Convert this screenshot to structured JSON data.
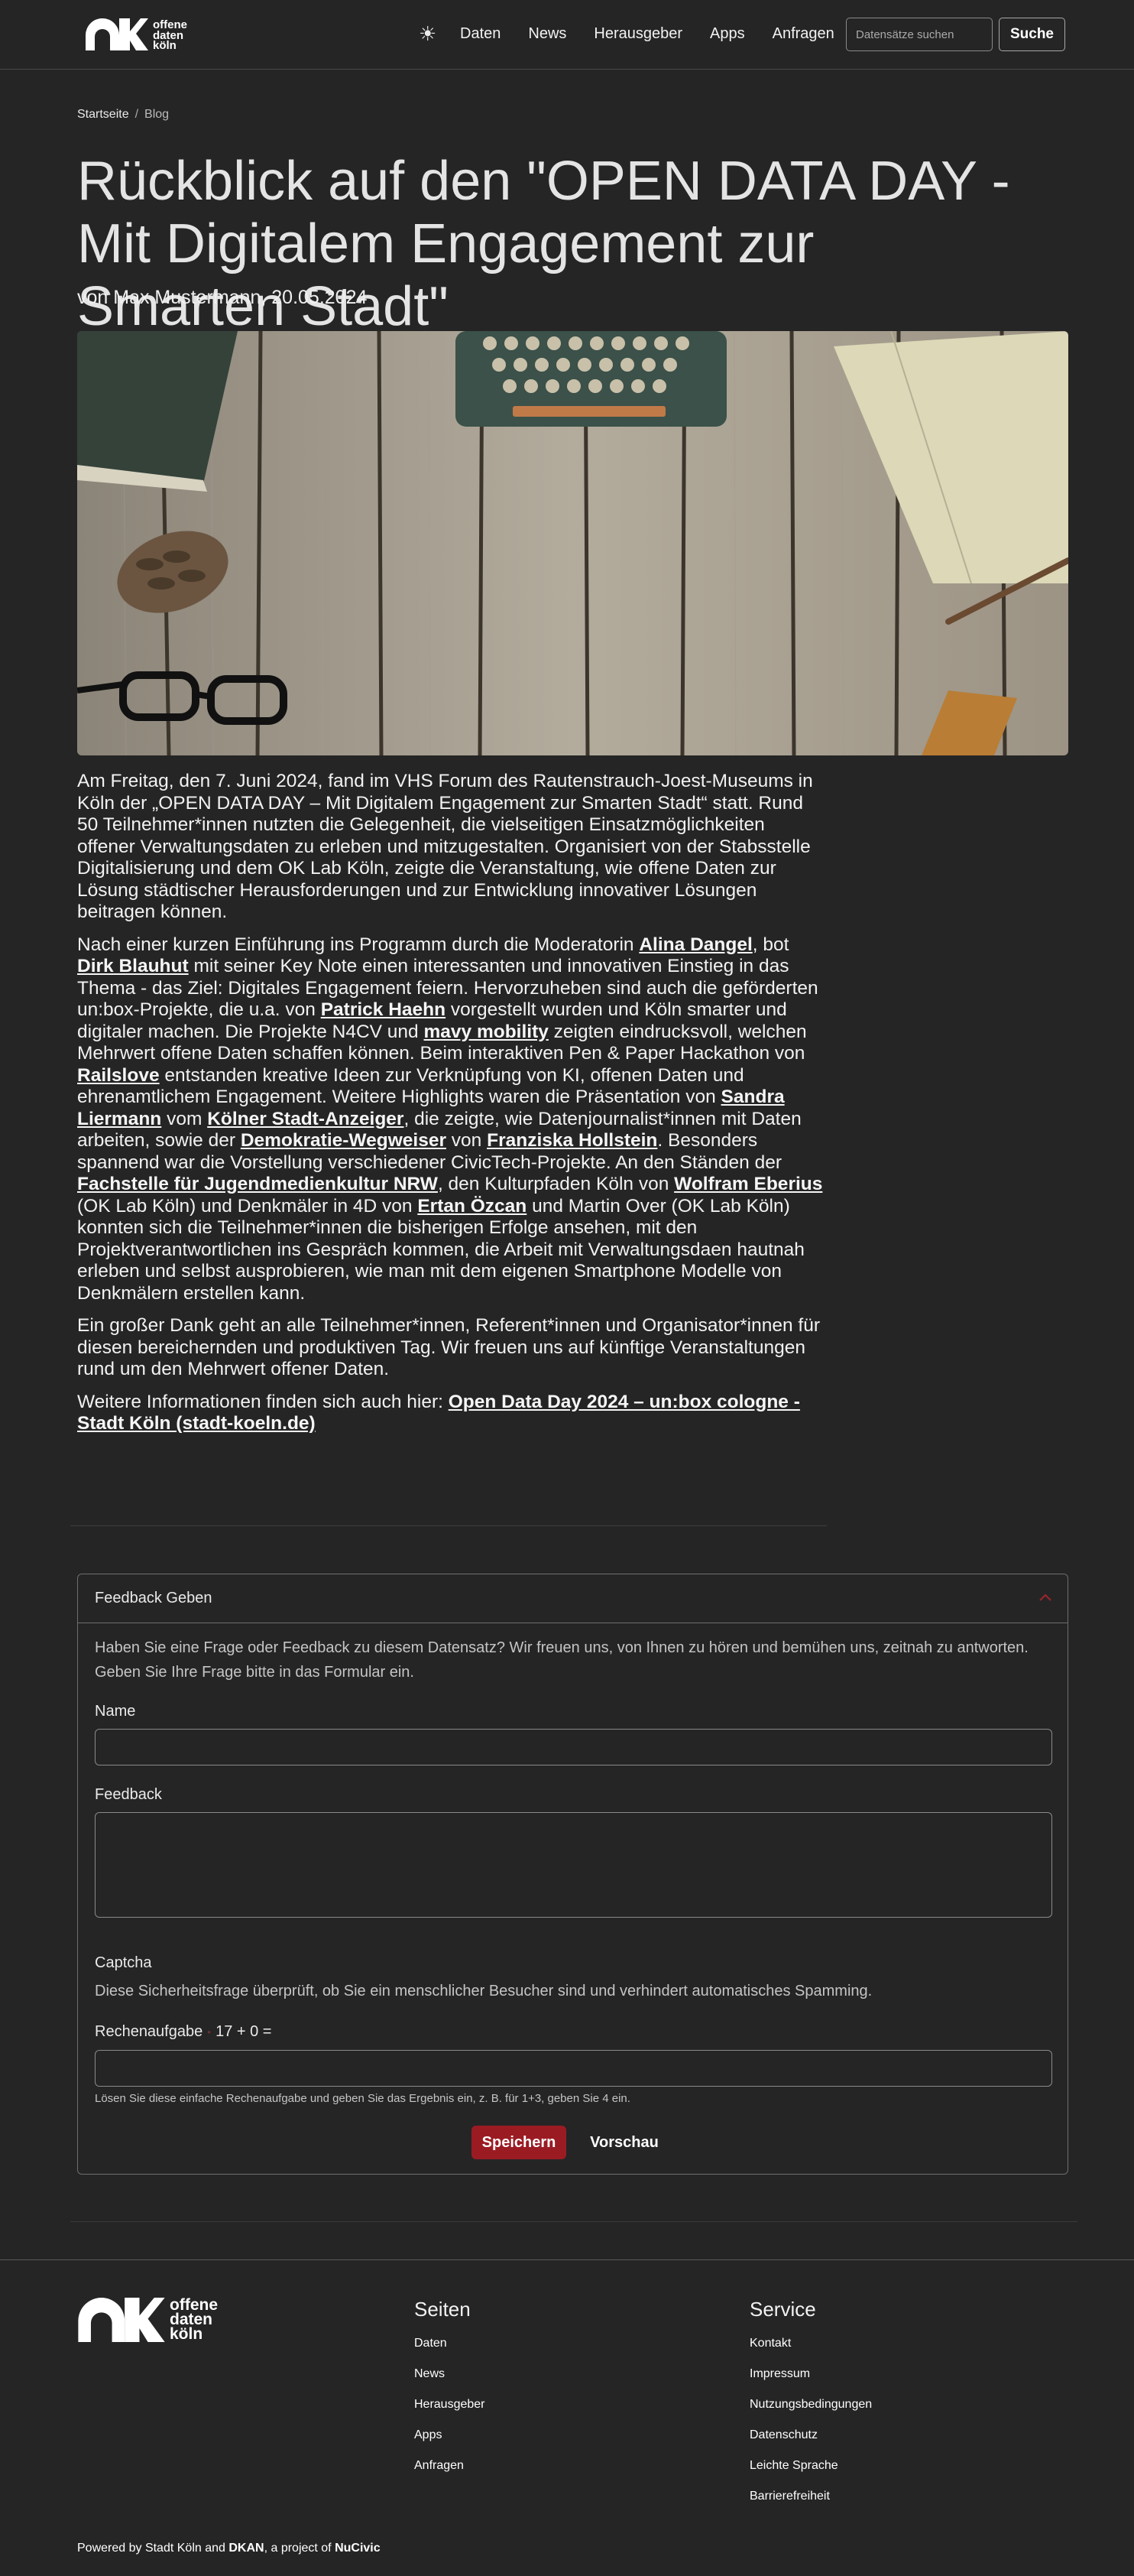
{
  "header": {
    "logo_lines": [
      "offene",
      "daten",
      "köln"
    ],
    "theme_icon": "☀",
    "nav": [
      "Daten",
      "News",
      "Herausgeber",
      "Apps",
      "Anfragen"
    ],
    "search_placeholder": "Datensätze suchen",
    "search_button": "Suche"
  },
  "breadcrumb": {
    "home": "Startseite",
    "separator": "/",
    "current": "Blog"
  },
  "article": {
    "title": "Rückblick auf den \"OPEN DATA DAY - Mit Digitalem Engagement zur Smarten Stadt\"",
    "byline": "von Max Mustermann, 20.05.2024",
    "p1": "Am Freitag, den 7. Juni 2024, fand im VHS Forum des Rautenstrauch-Joest-Museums in Köln der „OPEN DATA DAY – Mit Digitalem Engagement zur Smarten Stadt“ statt. Rund 50 Teilnehmer*innen nutzten die Gelegenheit, die vielseitigen Einsatzmöglichkeiten offener Verwaltungsdaten zu erleben und mitzugestalten. Organisiert von der Stabsstelle Digitalisierung und dem OK Lab Köln, zeigte die Veranstaltung, wie offene Daten zur Lösung städtischer Herausforderungen und zur Entwicklung innovativer Lösungen beitragen können.",
    "p2": {
      "t1": "Nach einer kurzen Einführung ins Programm durch die Moderatorin ",
      "l1": "Alina Dangel",
      "t2": ", bot ",
      "l2": "Dirk Blauhut",
      "t3": " mit seiner Key Note einen interessanten und innovativen Einstieg in das Thema - das Ziel: Digitales Engagement feiern. Hervorzuheben sind auch die geförderten un:box-Projekte, die u.a. von ",
      "l3": "Patrick Haehn",
      "t4": " vorgestellt wurden und Köln smarter und digitaler machen. Die Projekte N4CV und ",
      "l4": "mavy mobility",
      "t5": " zeigten eindrucksvoll, welchen Mehrwert offene Daten schaffen können. Beim interaktiven Pen & Paper Hackathon von ",
      "l5": "Railslove",
      "t6": " entstanden kreative Ideen zur Verknüpfung von KI, offenen Daten und ehrenamtlichem Engagement. Weitere Highlights waren die Präsentation von ",
      "l6": "Sandra Liermann",
      "t7": " vom ",
      "l7": "Kölner Stadt-Anzeiger",
      "t8": ", die zeigte, wie Datenjournalist*innen mit Daten arbeiten, sowie der ",
      "l8": "Demokratie-Wegweiser",
      "t9": " von ",
      "l9": "Franziska Hollstein",
      "t10": ". Besonders spannend war die Vorstellung verschiedener CivicTech-Projekte. An den Ständen der ",
      "l10": "Fachstelle für Jugendmedienkultur NRW",
      "t11": ", den Kulturpfaden Köln von ",
      "l11": "Wolfram Eberius",
      "t12": " (OK Lab Köln) und Denkmäler in 4D von ",
      "l12": "Ertan Özcan",
      "t13": " und Martin Over (OK Lab Köln) konnten sich die Teilnehmer*innen die bisherigen Erfolge ansehen, mit den Projektverantwortlichen ins Gespräch kommen, die Arbeit mit Verwaltungsdaen hautnah erleben und selbst ausprobieren, wie man mit dem eigenen Smartphone Modelle von Denkmälern erstellen kann."
    },
    "p3": "Ein großer Dank geht an alle Teilnehmer*innen, Referent*innen und Organisator*innen für diesen bereichernden und produktiven Tag. Wir freuen uns auf künftige Veranstaltungen rund um den Mehrwert offener Daten.",
    "p4_text": "Weitere Informationen finden sich auch hier: ",
    "p4_link": "Open Data Day 2024 – un:box cologne - Stadt Köln (stadt-koeln.de)"
  },
  "feedback": {
    "title": "Feedback Geben",
    "intro": "Haben Sie eine Frage oder Feedback zu diesem Datensatz? Wir freuen uns, von Ihnen zu hören und bemühen uns, zeitnah zu antworten. Geben Sie Ihre Frage bitte in das Formular ein.",
    "name_label": "Name",
    "name_value": "",
    "feedback_label": "Feedback",
    "feedback_value": "",
    "captcha_title": "Captcha",
    "captcha_desc": "Diese Sicherheitsfrage überprüft, ob Sie ein menschlicher Besucher sind und verhindert automatisches Spamming.",
    "math_label": "Rechenaufgabe",
    "math_task": "17 + 0 =",
    "math_value": "",
    "hint": "Lösen Sie diese einfache Rechenaufgabe und geben Sie das Ergebnis ein, z. B. für 1+3, geben Sie 4 ein.",
    "save": "Speichern",
    "preview": "Vorschau"
  },
  "footer": {
    "logo_lines": [
      "offene",
      "daten",
      "köln"
    ],
    "seiten_title": "Seiten",
    "seiten": [
      "Daten",
      "News",
      "Herausgeber",
      "Apps",
      "Anfragen"
    ],
    "service_title": "Service",
    "service": [
      "Kontakt",
      "Impressum",
      "Nutzungsbedingungen",
      "Datenschutz",
      "Leichte Sprache",
      "Barrierefreiheit"
    ],
    "powered_prefix": "Powered by Stadt Köln and ",
    "powered_link1": "DKAN",
    "powered_mid": ", a project of ",
    "powered_link2": "NuCivic"
  },
  "colors": {
    "background": "#252525",
    "accent": "#9b1b23"
  }
}
